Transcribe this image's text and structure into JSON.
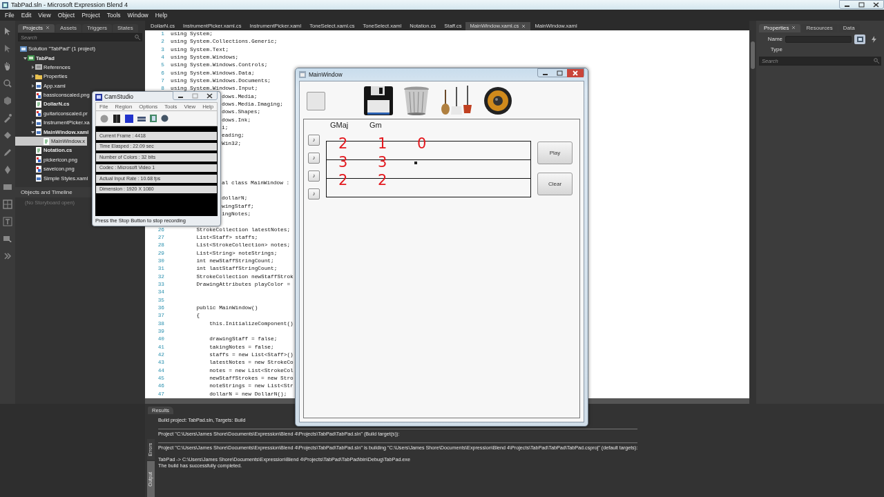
{
  "window": {
    "title": "TabPad.sln - Microsoft Expression Blend 4"
  },
  "menu": [
    "File",
    "Edit",
    "View",
    "Object",
    "Project",
    "Tools",
    "Window",
    "Help"
  ],
  "left_panel": {
    "tabs": [
      {
        "label": "Projects",
        "selected": true
      },
      {
        "label": "Assets",
        "selected": false
      },
      {
        "label": "Triggers",
        "selected": false
      },
      {
        "label": "States",
        "selected": false
      }
    ],
    "search": {
      "placeholder": "Search"
    },
    "tree": [
      {
        "label": "Solution \"TabPad\" (1 project)",
        "kind": "solution",
        "bold": false,
        "selected": false,
        "children": [
          {
            "label": "TabPad",
            "kind": "project",
            "bold": true,
            "selected": false,
            "expanded": true,
            "children": [
              {
                "label": "References",
                "kind": "references",
                "bold": false,
                "selected": false,
                "expanded": false
              },
              {
                "label": "Properties",
                "kind": "folder",
                "bold": false,
                "selected": false,
                "expanded": false
              },
              {
                "label": "App.xaml",
                "kind": "xaml",
                "bold": false,
                "selected": false,
                "expanded": false
              },
              {
                "label": "bassiconscaled.png",
                "kind": "image",
                "bold": false,
                "selected": false
              },
              {
                "label": "DollarN.cs",
                "kind": "code",
                "bold": true,
                "selected": false
              },
              {
                "label": "guitariconscaled.pr",
                "kind": "image",
                "bold": false,
                "selected": false
              },
              {
                "label": "InstrumentPicker.xa",
                "kind": "xaml",
                "bold": false,
                "selected": false,
                "expanded": false
              },
              {
                "label": "MainWindow.xaml",
                "kind": "xaml",
                "bold": true,
                "selected": false,
                "expanded": true,
                "children": [
                  {
                    "label": "MainWindow.x",
                    "kind": "code",
                    "bold": false,
                    "selected": true
                  }
                ]
              },
              {
                "label": "Notation.cs",
                "kind": "code",
                "bold": true,
                "selected": false
              },
              {
                "label": "pickericon.png",
                "kind": "image",
                "bold": false,
                "selected": false
              },
              {
                "label": "saveicon.png",
                "kind": "image",
                "bold": false,
                "selected": false
              },
              {
                "label": "Simple Styles.xaml",
                "kind": "xaml",
                "bold": false,
                "selected": false
              }
            ]
          }
        ]
      }
    ],
    "timeline": {
      "title": "Objects and Timeline",
      "status": "(No Storyboard open)"
    }
  },
  "editor": {
    "tabs": [
      {
        "label": "DollarN.cs",
        "selected": false
      },
      {
        "label": "InstrumentPicker.xaml.cs",
        "selected": false
      },
      {
        "label": "InstrumentPicker.xaml",
        "selected": false
      },
      {
        "label": "ToneSelect.xaml.cs",
        "selected": false
      },
      {
        "label": "ToneSelect.xaml",
        "selected": false
      },
      {
        "label": "Notation.cs",
        "selected": false
      },
      {
        "label": "Staff.cs",
        "selected": false
      },
      {
        "label": "MainWindow.xaml.cs",
        "selected": true
      },
      {
        "label": "MainWindow.xaml",
        "selected": false
      }
    ],
    "lines": [
      {
        "kind": "full",
        "num": "1",
        "text": "using System;"
      },
      {
        "kind": "full",
        "num": "2",
        "text": "using System.Collections.Generic;"
      },
      {
        "kind": "full",
        "num": "3",
        "text": "using System.Text;"
      },
      {
        "kind": "full",
        "num": "4",
        "text": "using System.Windows;"
      },
      {
        "kind": "full",
        "num": "5",
        "text": "using System.Windows.Controls;"
      },
      {
        "kind": "full",
        "num": "6",
        "text": "using System.Windows.Data;"
      },
      {
        "kind": "full",
        "num": "7",
        "text": "using System.Windows.Documents;"
      },
      {
        "kind": "full",
        "num": "8",
        "text": "using System.Windows.Input;"
      },
      {
        "kind": "covered",
        "text": "dows.Media;"
      },
      {
        "kind": "covered",
        "text": "dows.Media.Imaging;"
      },
      {
        "kind": "covered",
        "text": "dows.Shapes;"
      },
      {
        "kind": "covered",
        "text": "dows.Ink;"
      },
      {
        "kind": "covered",
        "text": "i;"
      },
      {
        "kind": "covered",
        "text": "eading;"
      },
      {
        "kind": "covered",
        "text": "Win32;"
      },
      {
        "kind": "covered"
      },
      {
        "kind": "covered"
      },
      {
        "kind": "covered"
      },
      {
        "kind": "covered"
      },
      {
        "kind": "covered",
        "text": "al class MainWindow :"
      },
      {
        "kind": "covered"
      },
      {
        "kind": "covered",
        "text": "dollarN;"
      },
      {
        "kind": "covered",
        "text": "wingStaff;"
      },
      {
        "kind": "covered",
        "text": "ingNotes;"
      },
      {
        "kind": "covered"
      },
      {
        "kind": "full",
        "num": "26",
        "text": "        StrokeCollection latestNotes;"
      },
      {
        "kind": "full",
        "num": "27",
        "text": "        List<Staff> staffs;"
      },
      {
        "kind": "full",
        "num": "28",
        "text": "        List<StrokeCollection> notes;"
      },
      {
        "kind": "full",
        "num": "29",
        "text": "        List<String> noteStrings;"
      },
      {
        "kind": "full",
        "num": "30",
        "text": "        int newStaffStringCount;"
      },
      {
        "kind": "full",
        "num": "31",
        "text": "        int lastStaffStringCount;"
      },
      {
        "kind": "full",
        "num": "32",
        "text": "        StrokeCollection newStaffStrok"
      },
      {
        "kind": "full",
        "num": "33",
        "text": "        DrawingAttributes playColor ="
      },
      {
        "kind": "full",
        "num": "34"
      },
      {
        "kind": "full",
        "num": "35"
      },
      {
        "kind": "full",
        "num": "36",
        "text": "        public MainWindow()"
      },
      {
        "kind": "full",
        "num": "37",
        "text": "        {"
      },
      {
        "kind": "full",
        "num": "38",
        "text": "            this.InitializeComponent()"
      },
      {
        "kind": "full",
        "num": "39"
      },
      {
        "kind": "full",
        "num": "40",
        "text": "            drawingStaff = false;"
      },
      {
        "kind": "full",
        "num": "41",
        "text": "            takingNotes = false;"
      },
      {
        "kind": "full",
        "num": "42",
        "text": "            staffs = new List<Staff>()"
      },
      {
        "kind": "full",
        "num": "43",
        "text": "            latestNotes = new StrokeCo"
      },
      {
        "kind": "full",
        "num": "44",
        "text": "            notes = new List<StrokeCol"
      },
      {
        "kind": "full",
        "num": "45",
        "text": "            newStaffStrokes = new Stro"
      },
      {
        "kind": "full",
        "num": "46",
        "text": "            noteStrings = new List<Str"
      },
      {
        "kind": "full",
        "num": "47",
        "text": "            dollarN = new DollarN();"
      }
    ]
  },
  "right_panel": {
    "tabs": [
      {
        "label": "Properties",
        "selected": true
      },
      {
        "label": "Resources",
        "selected": false
      },
      {
        "label": "Data",
        "selected": false
      }
    ],
    "name_label": "Name",
    "type_label": "Type",
    "search": {
      "placeholder": "Search"
    }
  },
  "results": {
    "title": "Results",
    "side_tabs": [
      {
        "label": "Errors",
        "selected": false
      },
      {
        "label": "Output",
        "selected": true
      }
    ],
    "lines": [
      {
        "kind": "plain",
        "text": "Build project: TabPad.sln, Targets: Build"
      },
      {
        "kind": "ruled",
        "text": "Project \"C:\\Users\\James Shore\\Documents\\Expression\\Blend 4\\Projects\\TabPad\\TabPad.sln\" (Build target(s)):"
      },
      {
        "kind": "ruled",
        "text": "Project \"C:\\Users\\James Shore\\Documents\\Expression\\Blend 4\\Projects\\TabPad\\TabPad.sln\" is building \"C:\\Users\\James Shore\\Documents\\Expression\\Blend 4\\Projects\\TabPad\\TabPad\\TabPad.csproj\" (default targets):"
      },
      {
        "kind": "spaced",
        "text": "TabPad -> C:\\Users\\James Shore\\Documents\\Expression\\Blend 4\\Projects\\TabPad\\TabPad\\bin\\Debug\\TabPad.exe"
      },
      {
        "kind": "plain",
        "text": "The build has successfully completed."
      }
    ]
  },
  "camstudio": {
    "title": "CamStudio",
    "menu": [
      "File",
      "Region",
      "Options",
      "Tools",
      "View",
      "Help"
    ],
    "stats": [
      "Current Frame : 4418",
      "Time Elasped : 22.09 sec",
      "Number of Colors : 32 bits",
      "Codec : Microsoft Video 1",
      "Actual Input Rate : 10.68 fps",
      "Dimension : 1920 X 1080"
    ],
    "status": "Press the Stop Button to stop recording"
  },
  "app_window": {
    "title": "MainWindow",
    "chords": [
      {
        "label": "GMaj",
        "notes": [
          "2",
          "3",
          "2"
        ]
      },
      {
        "label": "Gm",
        "notes": [
          "1",
          "3",
          "2"
        ]
      },
      {
        "notes": [
          "0"
        ]
      }
    ],
    "string_buttons": [
      "♪",
      "♪",
      "♪",
      "♪"
    ],
    "buttons": [
      "Play",
      "Clear"
    ]
  }
}
